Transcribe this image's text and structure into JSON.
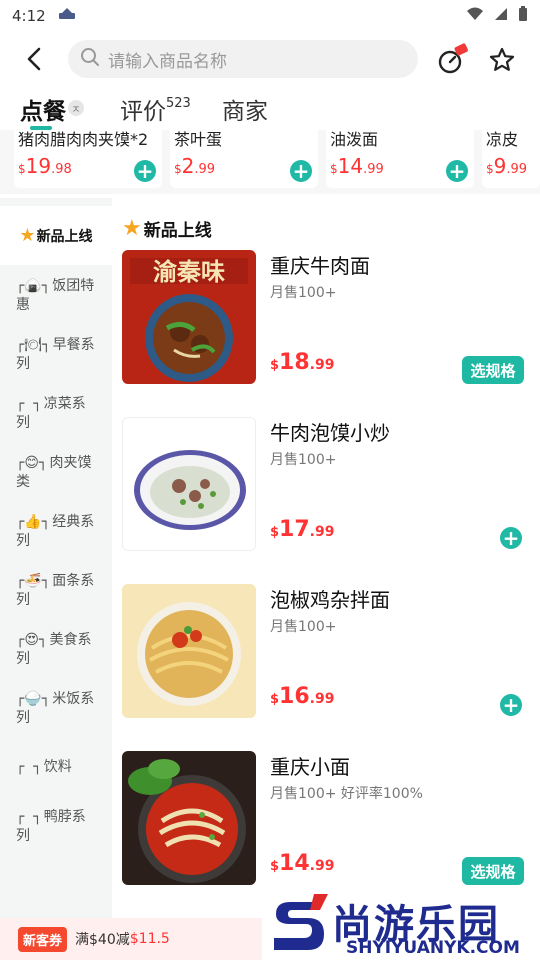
{
  "status_bar": {
    "time": "4:12"
  },
  "search": {
    "placeholder": "请输入商品名称"
  },
  "tabs": [
    {
      "label": "点餐"
    },
    {
      "label": "评价",
      "count": "523"
    },
    {
      "label": "商家"
    }
  ],
  "pin_badge": "ㅈ",
  "recommend": [
    {
      "name": "猪肉腊肉肉夹馍*2",
      "price_int": "19",
      "price_dec": ".98"
    },
    {
      "name": "茶叶蛋",
      "price_int": "2",
      "price_dec": ".99"
    },
    {
      "name": "油泼面",
      "price_int": "14",
      "price_dec": ".99"
    },
    {
      "name": "凉皮",
      "price_int": "9",
      "price_dec": ".99"
    }
  ],
  "currency": "$",
  "sidebar": [
    {
      "label": "新品上线",
      "icon": "star"
    },
    {
      "label": "饭团特惠",
      "icon": "rice-ball"
    },
    {
      "label": "早餐系列",
      "icon": "plate"
    },
    {
      "label": "凉菜系列",
      "icon": ""
    },
    {
      "label": "肉夹馍类",
      "icon": "face"
    },
    {
      "label": "经典系列",
      "icon": "thumbs-up"
    },
    {
      "label": "面条系列",
      "icon": "noodle-bowl"
    },
    {
      "label": "美食系列",
      "icon": "face-hearts"
    },
    {
      "label": "米饭系列",
      "icon": "rice"
    },
    {
      "label": "饮料",
      "icon": ""
    },
    {
      "label": "鸭脖系列",
      "icon": ""
    }
  ],
  "section": {
    "title": "新品上线"
  },
  "products": [
    {
      "name": "重庆牛肉面",
      "sales": "月售100+",
      "price_int": "18",
      "price_dec": ".99",
      "action": "选规格",
      "image_text": "渝秦味"
    },
    {
      "name": "牛肉泡馍小炒",
      "sales": "月售100+",
      "price_int": "17",
      "price_dec": ".99",
      "action": "plus"
    },
    {
      "name": "泡椒鸡杂拌面",
      "sales": "月售100+",
      "price_int": "16",
      "price_dec": ".99",
      "action": "plus"
    },
    {
      "name": "重庆小面",
      "sales": "月售100+ 好评率100%",
      "price_int": "14",
      "price_dec": ".99",
      "action": "选规格"
    }
  ],
  "coupon": {
    "tag": "新客券",
    "text": "满$40减",
    "amount": "$11.5"
  },
  "watermark": {
    "cn": "尚游乐园",
    "en": "SHYIYUANYK.COM"
  },
  "colors": {
    "accent": "#1fb8a3",
    "price": "#ff3333",
    "coupon": "#f4492f",
    "watermark": "#1f2b8f"
  }
}
